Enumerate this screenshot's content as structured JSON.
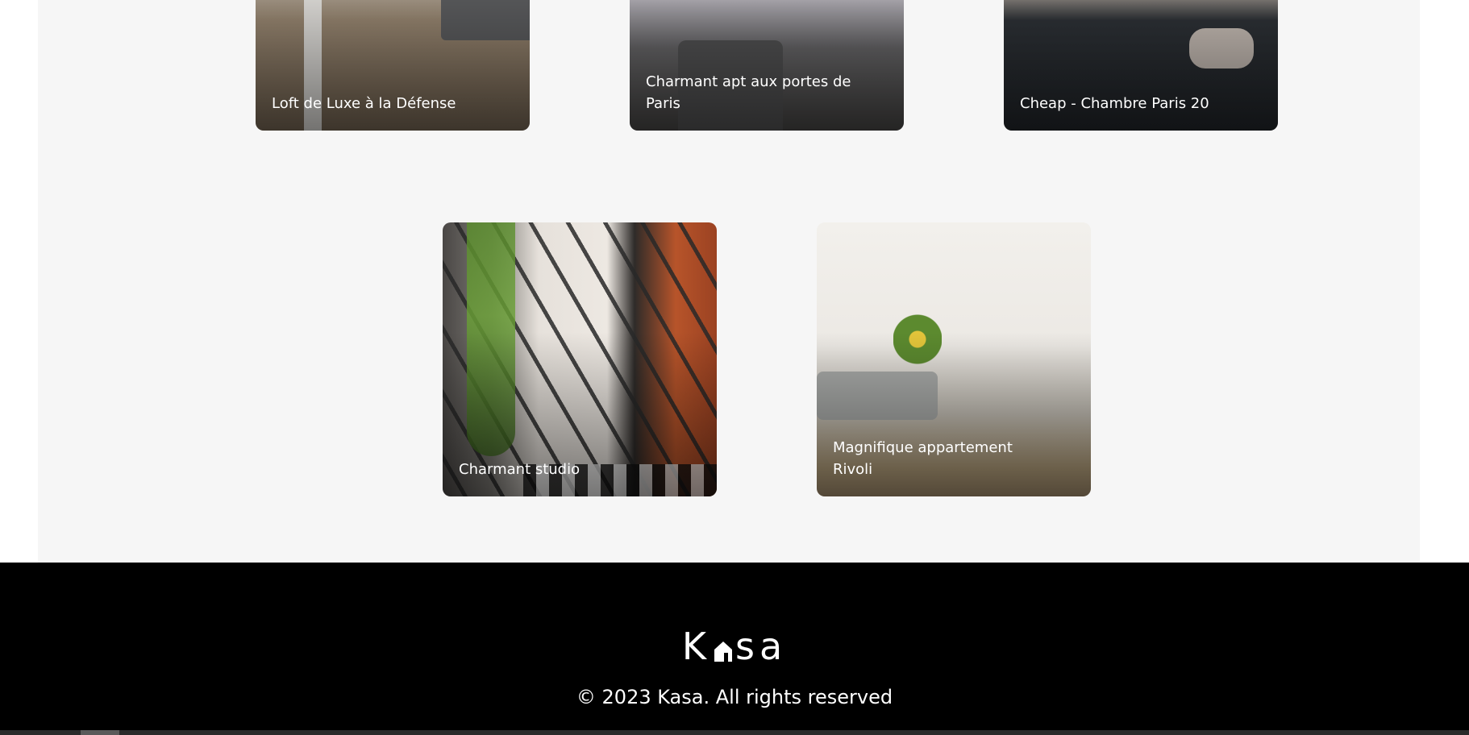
{
  "listings": [
    {
      "title": "Loft de Luxe à la Défense",
      "photo_icon": "loft-photo"
    },
    {
      "title": "Charmant apt aux portes de Paris",
      "photo_icon": "apartment-photo"
    },
    {
      "title": "Cheap - Chambre Paris 20",
      "photo_icon": "bedroom-photo"
    },
    {
      "title": "Charmant studio",
      "photo_icon": "studio-photo"
    },
    {
      "title": "Magnifique appartement Rivoli",
      "photo_icon": "living-room-photo"
    }
  ],
  "footer": {
    "logo_left": "K",
    "logo_right": "sa",
    "logo_icon": "house-icon",
    "copyright": "© 2023 Kasa. All rights reserved"
  },
  "colors": {
    "gallery_background": "#f6f6f6",
    "footer_background": "#000000",
    "text_on_card": "#ffffff"
  }
}
